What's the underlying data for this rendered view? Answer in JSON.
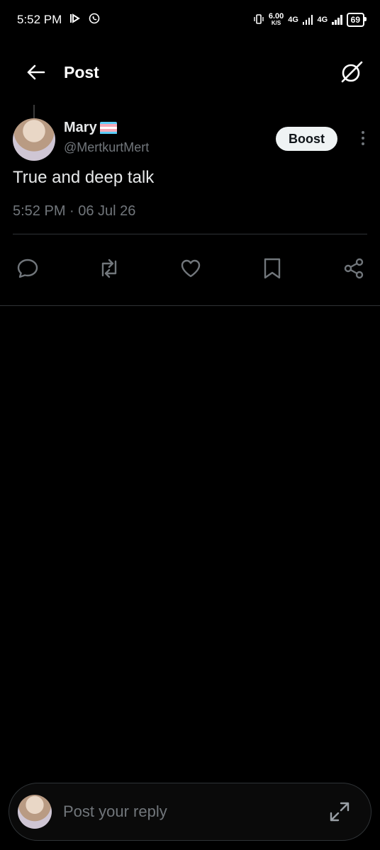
{
  "status_bar": {
    "time": "5:52 PM",
    "speed_value": "6.00",
    "speed_unit": "K/S",
    "network_1": "4G",
    "network_2": "4G",
    "battery": "69"
  },
  "header": {
    "title": "Post",
    "back_icon": "arrow-left-icon",
    "grok_icon": "grok-icon"
  },
  "post": {
    "display_name": "Mary",
    "flag_colors": [
      "#5BCEFA",
      "#F5A9B8",
      "#FFFFFF",
      "#F5A9B8",
      "#5BCEFA"
    ],
    "handle": "@MertkurtMert",
    "boost_label": "Boost",
    "text": "True and deep talk",
    "timestamp": "5:52 PM · 06 Jul 26"
  },
  "actions": [
    {
      "name": "reply",
      "icon": "comment-icon"
    },
    {
      "name": "repost",
      "icon": "repost-icon"
    },
    {
      "name": "like",
      "icon": "heart-icon"
    },
    {
      "name": "bookmark",
      "icon": "bookmark-icon"
    },
    {
      "name": "share",
      "icon": "share-icon"
    }
  ],
  "reply": {
    "placeholder": "Post your reply",
    "value": ""
  },
  "colors": {
    "background": "#000000",
    "text": "#e7e9ea",
    "muted": "#71767b",
    "divider": "#2f3336"
  }
}
